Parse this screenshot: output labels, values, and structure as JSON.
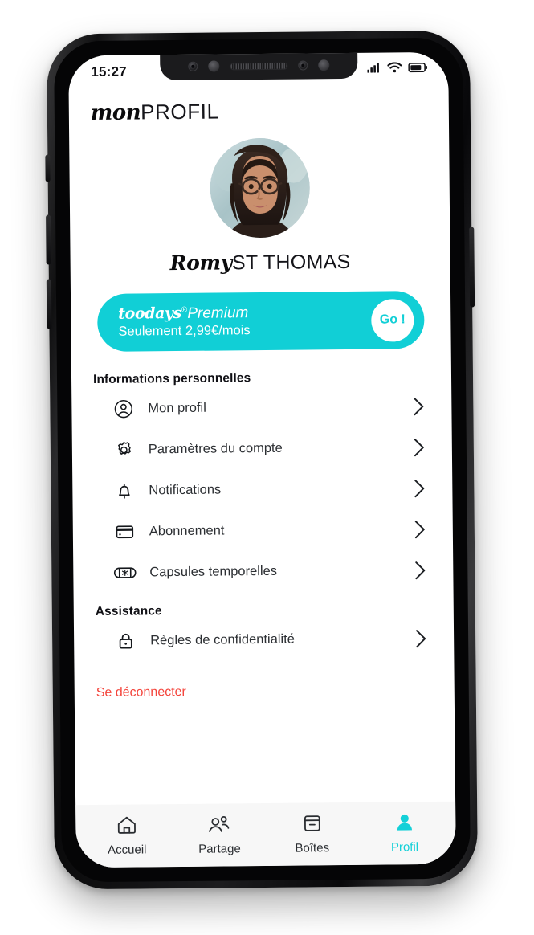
{
  "status_bar": {
    "time": "15:27",
    "icons": [
      "signal-icon",
      "wifi-icon",
      "battery-icon"
    ]
  },
  "header": {
    "title_bold": "mon",
    "title_light": "PROFIL"
  },
  "profile": {
    "avatar_alt": "avatar",
    "first_name": "Romy",
    "last_name": "ST THOMAS"
  },
  "premium": {
    "brand": "toodays",
    "registered": "®",
    "plan": "Premium",
    "price_line": "Seulement 2,99€/mois",
    "go_label": "Go !",
    "accent": "#11cfd6"
  },
  "sections": [
    {
      "heading": "Informations personnelles",
      "items": [
        {
          "label": "Mon profil",
          "icon": "user-circle-icon"
        },
        {
          "label": "Paramètres du compte",
          "icon": "gear-icon"
        },
        {
          "label": "Notifications",
          "icon": "bell-icon"
        },
        {
          "label": "Abonnement",
          "icon": "credit-card-icon"
        },
        {
          "label": "Capsules temporelles",
          "icon": "capsule-icon"
        }
      ]
    },
    {
      "heading": "Assistance",
      "items": [
        {
          "label": "Règles de confidentialité",
          "icon": "lock-icon"
        }
      ]
    }
  ],
  "logout": {
    "label": "Se déconnecter",
    "color": "#f4453c"
  },
  "tab_bar": {
    "active_color": "#14d0d8",
    "items": [
      {
        "label": "Accueil",
        "icon": "home-icon",
        "active": false
      },
      {
        "label": "Partage",
        "icon": "people-icon",
        "active": false
      },
      {
        "label": "Boîtes",
        "icon": "box-icon",
        "active": false
      },
      {
        "label": "Profil",
        "icon": "person-icon",
        "active": true
      }
    ]
  }
}
